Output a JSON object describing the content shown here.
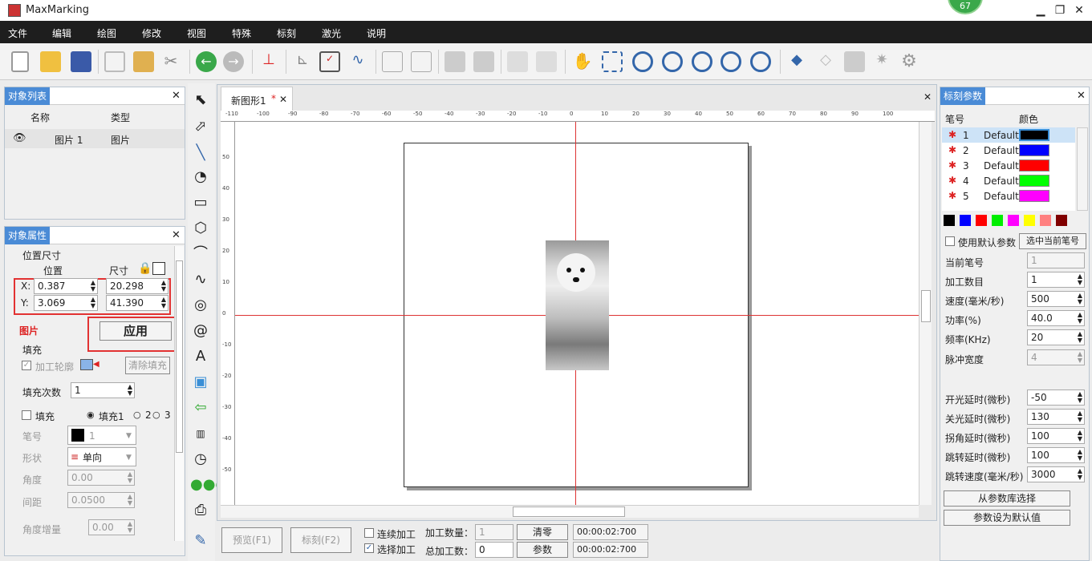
{
  "app": {
    "title": "MaxMarking",
    "badge": "67"
  },
  "menu": [
    "文件",
    "编辑",
    "绘图",
    "修改",
    "视图",
    "特殊",
    "标刻",
    "激光",
    "说明"
  ],
  "object_list": {
    "title": "对象列表",
    "col_name": "名称",
    "col_type": "类型",
    "rows": [
      {
        "name": "图片 1",
        "type": "图片"
      }
    ]
  },
  "object_props": {
    "title": "对象属性",
    "section_size": "位置尺寸",
    "pos_label": "位置",
    "size_label": "尺寸",
    "x_label": "X:",
    "y_label": "Y:",
    "x": "0.387",
    "y": "3.069",
    "w": "20.298",
    "h": "41.390",
    "image_label": "图片",
    "apply": "应用",
    "fill_section": "填充",
    "outline": "加工轮廓",
    "clear_fill": "清除填充",
    "fill_count_label": "填充次数",
    "fill_count": "1",
    "fill": "填充",
    "fill1": "填充1",
    "fill2": "2",
    "fill3": "3",
    "pen_label": "笔号",
    "pen_value": "1",
    "shape_label": "形状",
    "shape_value": "单向",
    "angle_label": "角度",
    "angle_value": "0.00",
    "spacing_label": "间距",
    "spacing_value": "0.0500",
    "angle_inc_label": "角度增量",
    "angle_inc_value": "0.00"
  },
  "document": {
    "tab": "新图形1",
    "tab_mark": "*"
  },
  "ruler_ticks": [
    "-110",
    "-100",
    "-90",
    "-80",
    "-70",
    "-60",
    "-50",
    "-40",
    "-30",
    "-20",
    "-10",
    "0",
    "10",
    "20",
    "30",
    "40",
    "50",
    "60",
    "70",
    "80",
    "90",
    "100"
  ],
  "vruler_ticks": [
    "50",
    "40",
    "30",
    "20",
    "10",
    "0",
    "-10",
    "-20",
    "-30",
    "-40",
    "-50"
  ],
  "bottom": {
    "preview": "预览(F1)",
    "mark": "标刻(F2)",
    "continuous": "连续加工",
    "select_process": "选择加工",
    "process_count_label": "加工数量：",
    "process_count": "1",
    "total_label": "总加工数：",
    "total": "0",
    "clear": "清零",
    "params": "参数",
    "time1": "00:00:02:700",
    "time2": "00:00:02:700"
  },
  "mark_params": {
    "title": "标刻参数",
    "col_pen": "笔号",
    "col_color": "颜色",
    "pens": [
      {
        "num": "1",
        "name": "Default",
        "color": "#000000"
      },
      {
        "num": "2",
        "name": "Default",
        "color": "#0000ff"
      },
      {
        "num": "3",
        "name": "Default",
        "color": "#ff0000"
      },
      {
        "num": "4",
        "name": "Default",
        "color": "#00ff00"
      },
      {
        "num": "5",
        "name": "Default",
        "color": "#ff00ff"
      }
    ],
    "palette": [
      "#000000",
      "#0000ff",
      "#ff0000",
      "#00ee00",
      "#ff00ff",
      "#ffff00",
      "#ff8080",
      "#800000"
    ],
    "use_default": "使用默认参数",
    "select_pen": "选中当前笔号",
    "current_pen_label": "当前笔号",
    "current_pen": "1",
    "count_label": "加工数目",
    "count": "1",
    "speed_label": "速度(毫米/秒)",
    "speed": "500",
    "power_label": "功率(%)",
    "power": "40.0",
    "freq_label": "频率(KHz)",
    "freq": "20",
    "pulse_label": "脉冲宽度",
    "pulse": "4",
    "on_delay_label": "开光延时(微秒)",
    "on_delay": "-50",
    "off_delay_label": "关光延时(微秒)",
    "off_delay": "130",
    "corner_delay_label": "拐角延时(微秒)",
    "corner_delay": "100",
    "jump_delay_label": "跳转延时(微秒)",
    "jump_delay": "100",
    "jump_speed_label": "跳转速度(毫米/秒)",
    "jump_speed": "3000",
    "from_lib": "从参数库选择",
    "set_default": "参数设为默认值"
  }
}
